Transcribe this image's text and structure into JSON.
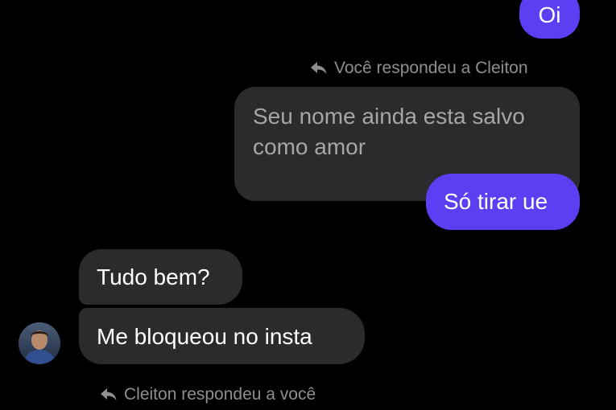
{
  "messages": {
    "top_sent": "Oi",
    "reply_note_you": "Você respondeu a Cleiton",
    "quoted_text": "Seu nome ainda esta salvo como amor",
    "sent_reply": "Só tirar ue",
    "received_1": "Tudo bem?",
    "received_2": "Me bloqueou no insta",
    "reply_note_contact": "Cleiton respondeu a você"
  },
  "icons": {
    "reply": "reply-arrow-icon",
    "avatar": "contact-avatar"
  },
  "colors": {
    "background": "#000000",
    "sent_bubble": "#5b3ff2",
    "received_bubble": "#2b2b2d",
    "muted_text": "#8e8e93",
    "quoted_text": "#a6a6a8"
  }
}
